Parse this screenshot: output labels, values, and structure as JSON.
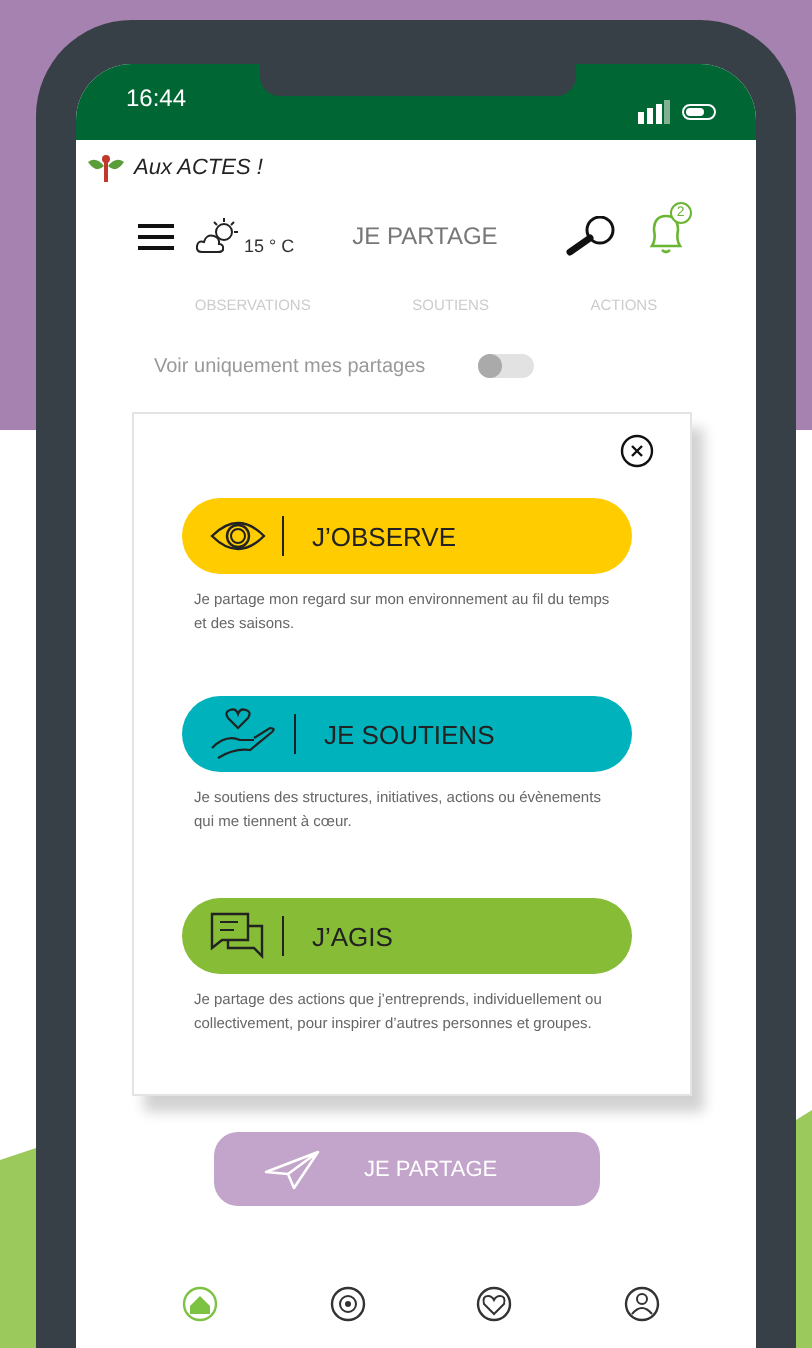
{
  "status_bar": {
    "time": "16:44"
  },
  "app": {
    "logo_text": "Aux ACTES !"
  },
  "header": {
    "temperature": "15 ° C",
    "title": "JE PARTAGE",
    "notification_count": "2"
  },
  "tabs": [
    {
      "label": "OBSERVATIONS",
      "selected": false
    },
    {
      "label": "SOUTIENS",
      "selected": false
    },
    {
      "label": "ACTIONS",
      "selected": false
    }
  ],
  "filter": {
    "label": "Voir uniquement mes partages",
    "on": false
  },
  "dialog": {
    "options": [
      {
        "kind": "observe",
        "label": "J’OBSERVE",
        "color": "#ffcc00",
        "description": "Je partage mon regard sur mon environnement au fil du temps et des saisons."
      },
      {
        "kind": "support",
        "label": "JE SOUTIENS",
        "color": "#00b2bb",
        "description": "Je soutiens des structures, initiatives, actions ou évènements qui me tiennent à cœur."
      },
      {
        "kind": "act",
        "label": "J’AGIS",
        "color": "#86bc36",
        "description": "Je partage des actions que j’entreprends, individuellement ou collectivement, pour inspirer d’autres personnes et groupes."
      }
    ]
  },
  "share_button": {
    "label": "JE PARTAGE"
  },
  "bottom_nav": [
    {
      "kind": "home",
      "selected": true
    },
    {
      "kind": "target",
      "selected": false
    },
    {
      "kind": "heart",
      "selected": false
    },
    {
      "kind": "profile",
      "selected": false
    }
  ]
}
